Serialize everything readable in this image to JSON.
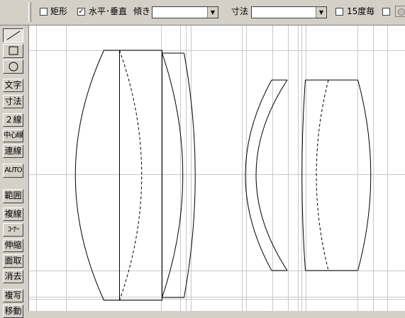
{
  "toolbar": {
    "rect_label": "矩形",
    "rect_checked": false,
    "hv_label": "水平･垂直",
    "hv_checked": true,
    "tilt_label": "傾き",
    "tilt_value": "",
    "dim_label": "寸法",
    "dim_value": "",
    "deg15_label": "15度毎",
    "deg15_checked": false,
    "extra_checked": false
  },
  "palette": {
    "line_icon": "line-icon",
    "rect_icon": "rectangle-icon",
    "circle_icon": "circle-icon",
    "text": "文字",
    "dimension": "寸法",
    "double_line": "２線",
    "center_line": "中心線",
    "continuous_line": "連線",
    "auto": "AUTO",
    "range": "範囲",
    "multi_line": "複線",
    "corner": "ｺｰﾅｰ",
    "stretch": "伸縮",
    "chamfer": "面取",
    "erase": "消去",
    "copy": "複写",
    "move": "移動"
  },
  "colors": {
    "face": "#d4d0c8",
    "canvas": "#ffffff",
    "grid": "#c8c8c8",
    "stroke": "#000000"
  }
}
